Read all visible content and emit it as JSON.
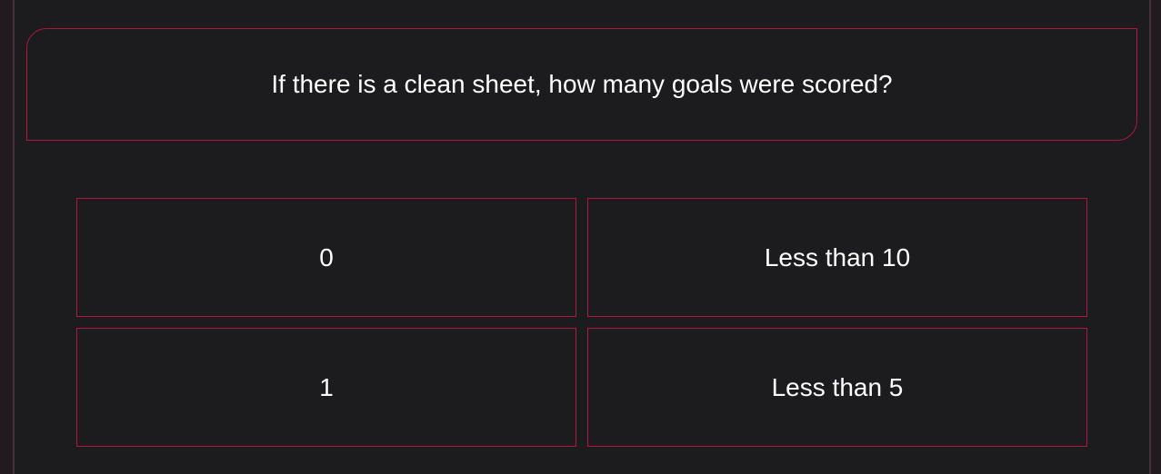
{
  "question": {
    "text": "If there is a clean sheet, how many goals were scored?"
  },
  "answers": [
    {
      "label": "0"
    },
    {
      "label": "Less than 10"
    },
    {
      "label": "1"
    },
    {
      "label": "Less than 5"
    }
  ],
  "colors": {
    "background": "#1c1b1e",
    "accent_border": "#b0173f",
    "text": "#ffffff",
    "side_panel": "#231a20"
  }
}
